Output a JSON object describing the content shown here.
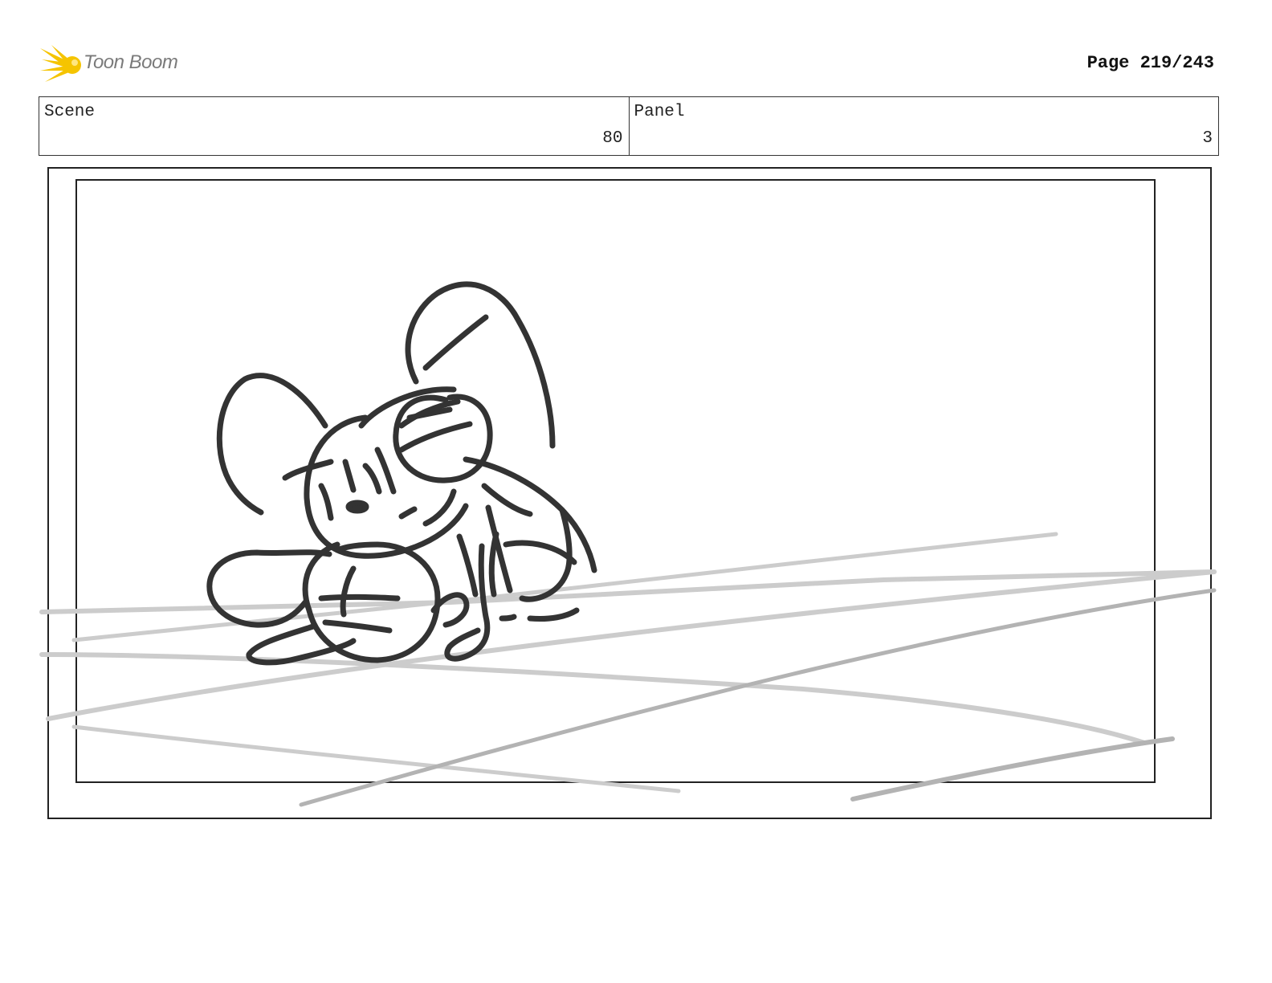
{
  "header": {
    "logo_text": "Toon Boom",
    "logo_icon": "starburst-icon",
    "page_label": "Page 219/243"
  },
  "info": {
    "scene_label": "Scene",
    "scene_value": "80",
    "panel_label": "Panel",
    "panel_value": "3"
  },
  "colors": {
    "logo_yellow": "#f5c400",
    "logo_text": "#7a7a7a",
    "ink": "#333333",
    "floor_light": "#cccccc",
    "floor_dark": "#b3b3b3"
  }
}
